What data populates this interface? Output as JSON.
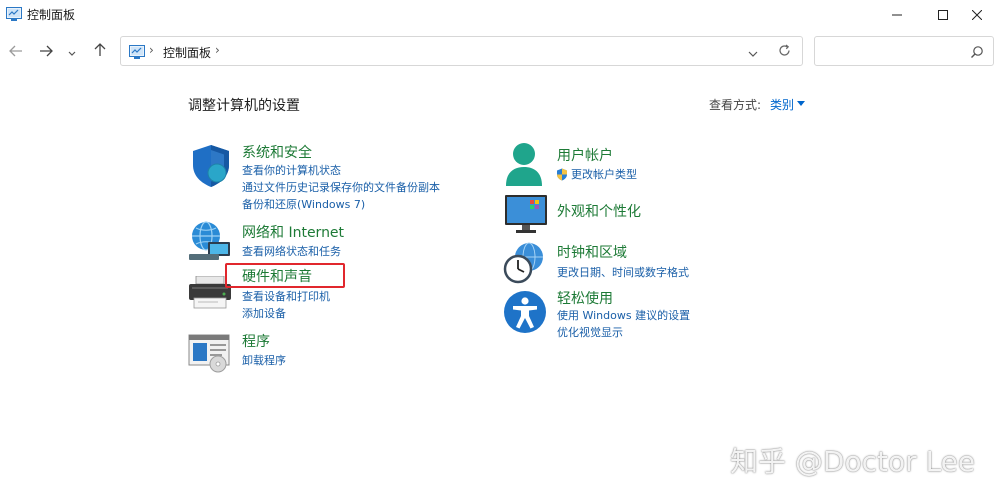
{
  "window": {
    "title": "控制面板",
    "icon": "control-panel-icon",
    "controls": {
      "minimize": "minimize-icon",
      "maximize": "maximize-icon",
      "close": "close-icon"
    }
  },
  "nav": {
    "back": "arrow-left-icon",
    "forward": "arrow-right-icon",
    "recent": "chevron-down-icon",
    "up": "arrow-up-icon"
  },
  "address": {
    "crumbs": [
      "控制面板"
    ],
    "separator": "›",
    "dropdown": "chevron-down-icon",
    "refresh": "refresh-icon"
  },
  "search": {
    "value": "",
    "placeholder": "",
    "icon": "search-icon"
  },
  "page": {
    "heading": "调整计算机的设置",
    "view_by_label": "查看方式:",
    "view_by_value": "类别"
  },
  "left_categories": [
    {
      "title": "系统和安全",
      "icon": "shield-icon",
      "links": [
        "查看你的计算机状态",
        "通过文件历史记录保存你的文件备份副本",
        "备份和还原(Windows 7)"
      ]
    },
    {
      "title": "网络和 Internet",
      "icon": "network-globe-icon",
      "links": [
        "查看网络状态和任务"
      ]
    },
    {
      "title": "硬件和声音",
      "icon": "printer-icon",
      "links": [
        "查看设备和打印机",
        "添加设备"
      ]
    },
    {
      "title": "程序",
      "icon": "programs-icon",
      "links": [
        "卸载程序"
      ]
    }
  ],
  "right_categories": [
    {
      "title": "用户帐户",
      "icon": "user-icon",
      "links": [
        "更改帐户类型"
      ],
      "link_icon": "uac-shield-icon"
    },
    {
      "title": "外观和个性化",
      "icon": "monitor-icon",
      "links": []
    },
    {
      "title": "时钟和区域",
      "icon": "clock-globe-icon",
      "links": [
        "更改日期、时间或数字格式"
      ]
    },
    {
      "title": "轻松使用",
      "icon": "accessibility-icon",
      "links": [
        "使用 Windows 建议的设置",
        "优化视觉显示"
      ]
    }
  ],
  "watermark": "知乎 @Doctor Lee",
  "colors": {
    "category_title": "#1d7a36",
    "link": "#1a5fa8",
    "highlight": "#e1272d",
    "accent": "#0066cc"
  }
}
